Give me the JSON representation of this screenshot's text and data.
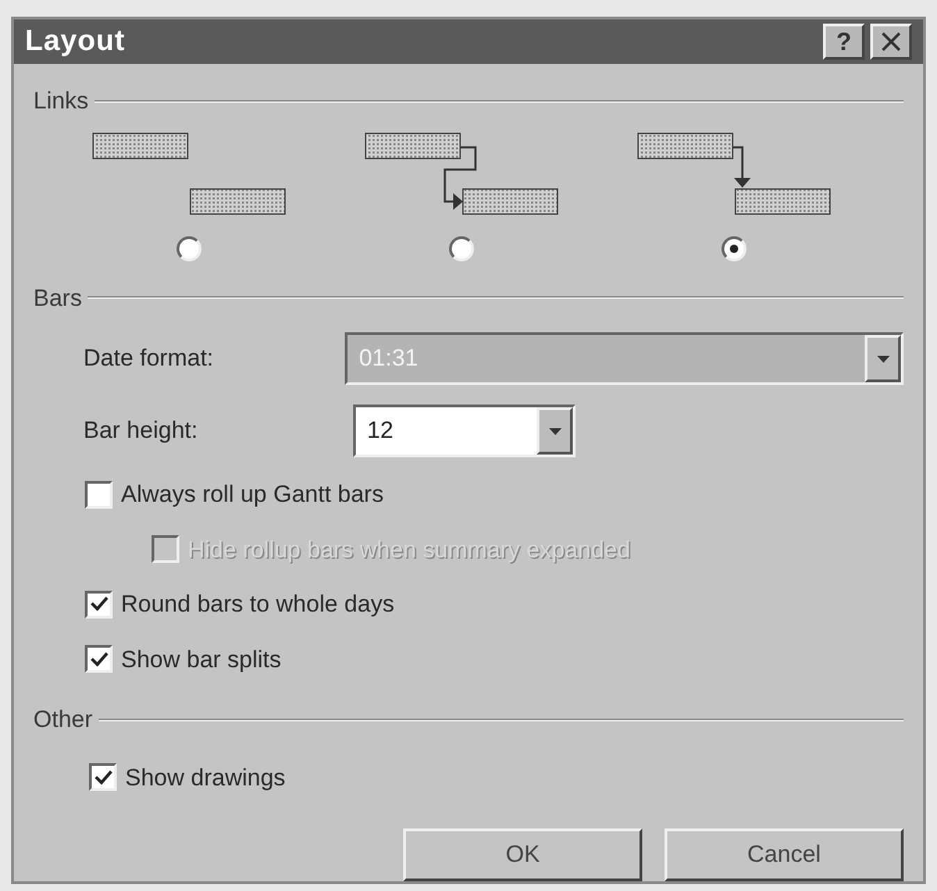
{
  "window": {
    "title": "Layout",
    "help_button": "?"
  },
  "links": {
    "title": "Links",
    "options": [
      {
        "kind": "none",
        "selected": false
      },
      {
        "kind": "elbow",
        "selected": false
      },
      {
        "kind": "drop",
        "selected": true
      }
    ]
  },
  "bars": {
    "title": "Bars",
    "fields": [
      {
        "label": "Date format:",
        "value": "01:31",
        "disabled": true,
        "kind": "wide"
      },
      {
        "label": "Bar height:",
        "value": "12",
        "disabled": false,
        "kind": "narrow"
      }
    ],
    "checkboxes": [
      {
        "label": "Always roll up Gantt bars",
        "checked": false,
        "disabled": false,
        "children": [
          {
            "label": "Hide rollup bars when summary expanded",
            "checked": false,
            "disabled": true
          }
        ]
      },
      {
        "label": "Round bars to whole days",
        "checked": true,
        "disabled": false
      },
      {
        "label": "Show bar splits",
        "checked": true,
        "disabled": false
      }
    ]
  },
  "other": {
    "title": "Other",
    "checkboxes": [
      {
        "label": "Show drawings",
        "checked": true,
        "disabled": false
      }
    ]
  },
  "buttons": [
    "OK",
    "Cancel"
  ]
}
